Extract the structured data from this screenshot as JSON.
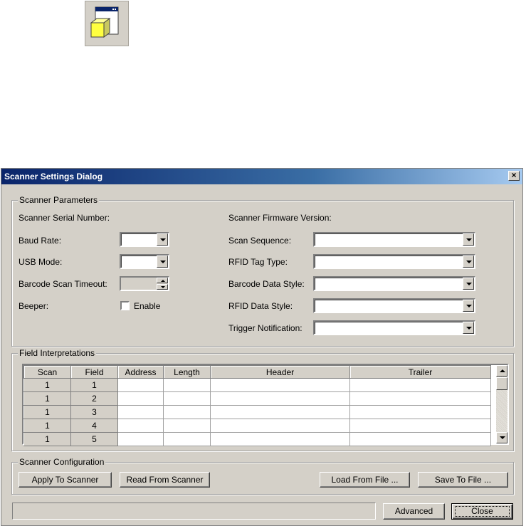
{
  "dialog": {
    "title": "Scanner Settings Dialog",
    "close_glyph": "×"
  },
  "params": {
    "legend": "Scanner Parameters",
    "serial_label": "Scanner Serial Number:",
    "firmware_label": "Scanner Firmware Version:",
    "baud_label": "Baud Rate:",
    "baud_value": "",
    "usb_label": "USB Mode:",
    "usb_value": "",
    "timeout_label": "Barcode Scan Timeout:",
    "timeout_value": "",
    "beeper_label": "Beeper:",
    "enable_label": "Enable",
    "enable_checked": false,
    "scan_seq_label": "Scan Sequence:",
    "scan_seq_value": "",
    "rfid_type_label": "RFID Tag Type:",
    "rfid_type_value": "",
    "barcode_style_label": "Barcode Data Style:",
    "barcode_style_value": "",
    "rfid_style_label": "RFID Data Style:",
    "rfid_style_value": "",
    "trigger_label": "Trigger Notification:",
    "trigger_value": ""
  },
  "fields": {
    "legend": "Field Interpretations",
    "columns": [
      "Scan",
      "Field",
      "Address",
      "Length",
      "Header",
      "Trailer"
    ],
    "rows": [
      [
        "1",
        "1",
        "",
        "",
        "",
        ""
      ],
      [
        "1",
        "2",
        "",
        "",
        "",
        ""
      ],
      [
        "1",
        "3",
        "",
        "",
        "",
        ""
      ],
      [
        "1",
        "4",
        "",
        "",
        "",
        ""
      ],
      [
        "1",
        "5",
        "",
        "",
        "",
        ""
      ]
    ]
  },
  "config": {
    "legend": "Scanner Configuration",
    "apply_label": "Apply To Scanner",
    "read_label": "Read From Scanner",
    "load_label": "Load From File ...",
    "save_label": "Save To File ..."
  },
  "footer": {
    "status_text": "",
    "advanced_label": "Advanced",
    "close_label": "Close"
  }
}
